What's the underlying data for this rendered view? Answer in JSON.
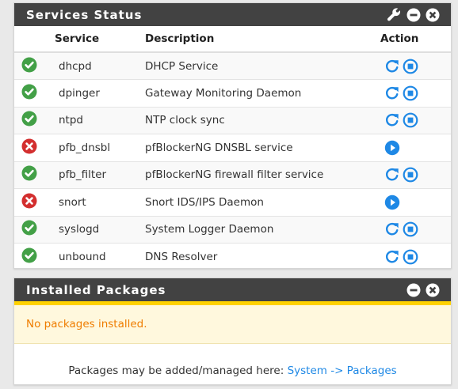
{
  "services_panel": {
    "title": "Services Status",
    "columns": {
      "service": "Service",
      "description": "Description",
      "action": "Action"
    },
    "rows": [
      {
        "name": "dhcpd",
        "description": "DHCP Service",
        "status": "running",
        "actions": [
          "restart-icon",
          "stop-icon"
        ]
      },
      {
        "name": "dpinger",
        "description": "Gateway Monitoring Daemon",
        "status": "running",
        "actions": [
          "restart-icon",
          "stop-icon"
        ]
      },
      {
        "name": "ntpd",
        "description": "NTP clock sync",
        "status": "running",
        "actions": [
          "restart-icon",
          "stop-icon"
        ]
      },
      {
        "name": "pfb_dnsbl",
        "description": "pfBlockerNG DNSBL service",
        "status": "stopped",
        "actions": [
          "start-icon"
        ]
      },
      {
        "name": "pfb_filter",
        "description": "pfBlockerNG firewall filter service",
        "status": "running",
        "actions": [
          "restart-icon",
          "stop-icon"
        ]
      },
      {
        "name": "snort",
        "description": "Snort IDS/IPS Daemon",
        "status": "stopped",
        "actions": [
          "start-icon"
        ]
      },
      {
        "name": "syslogd",
        "description": "System Logger Daemon",
        "status": "running",
        "actions": [
          "restart-icon",
          "stop-icon"
        ]
      },
      {
        "name": "unbound",
        "description": "DNS Resolver",
        "status": "running",
        "actions": [
          "restart-icon",
          "stop-icon"
        ]
      }
    ]
  },
  "packages_panel": {
    "title": "Installed Packages",
    "alert": "No packages installed.",
    "footer_prefix": "Packages may be added/managed here: ",
    "footer_link": "System -> Packages"
  },
  "colors": {
    "heading_bg": "#424242",
    "running": "#43a047",
    "stopped": "#d32f2f",
    "action": "#1e88e5",
    "alert_bar": "#ffd200",
    "alert_text": "#ef7d00"
  },
  "heading_icons": [
    "wrench-icon",
    "minimize-icon",
    "close-icon"
  ]
}
